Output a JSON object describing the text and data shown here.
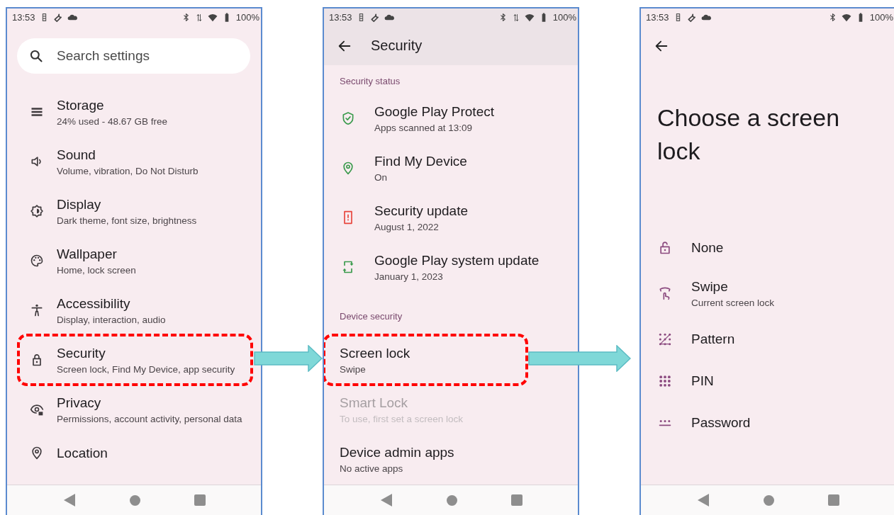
{
  "settings_screen": {
    "status_bar": {
      "time": "13:53",
      "battery": "100%"
    },
    "search": {
      "placeholder": "Search settings"
    },
    "items": [
      {
        "title": "Storage",
        "subtitle": "24% used - 48.67 GB free",
        "highlighted": false
      },
      {
        "title": "Sound",
        "subtitle": "Volume, vibration, Do Not Disturb",
        "highlighted": false
      },
      {
        "title": "Display",
        "subtitle": "Dark theme, font size, brightness",
        "highlighted": false
      },
      {
        "title": "Wallpaper",
        "subtitle": "Home, lock screen",
        "highlighted": false
      },
      {
        "title": "Accessibility",
        "subtitle": "Display, interaction, audio",
        "highlighted": false
      },
      {
        "title": "Security",
        "subtitle": "Screen lock, Find My Device, app security",
        "highlighted": true
      },
      {
        "title": "Privacy",
        "subtitle": "Permissions, account activity, personal data",
        "highlighted": false
      },
      {
        "title": "Location",
        "highlighted": false
      }
    ]
  },
  "security_screen": {
    "status_bar": {
      "time": "13:53",
      "battery": "100%"
    },
    "title": "Security",
    "sections": [
      {
        "header": "Security status",
        "items": [
          {
            "title": "Google Play Protect",
            "subtitle": "Apps scanned at 13:09",
            "highlighted": false,
            "disabled": false
          },
          {
            "title": "Find My Device",
            "subtitle": "On",
            "highlighted": false,
            "disabled": false
          },
          {
            "title": "Security update",
            "subtitle": "August 1, 2022",
            "highlighted": false,
            "disabled": false
          },
          {
            "title": "Google Play system update",
            "subtitle": "January 1, 2023",
            "highlighted": false,
            "disabled": false
          }
        ]
      },
      {
        "header": "Device security",
        "items": [
          {
            "title": "Screen lock",
            "subtitle": "Swipe",
            "highlighted": true,
            "disabled": false
          },
          {
            "title": "Smart Lock",
            "subtitle": "To use, first set a screen lock",
            "highlighted": false,
            "disabled": true
          },
          {
            "title": "Device admin apps",
            "subtitle": "No active apps",
            "highlighted": false,
            "disabled": false
          }
        ]
      }
    ]
  },
  "lock_screen_picker": {
    "status_bar": {
      "time": "13:53",
      "battery": "100%"
    },
    "title": "Choose a screen lock",
    "options": [
      {
        "title": "None"
      },
      {
        "title": "Swipe",
        "subtitle": "Current screen lock"
      },
      {
        "title": "Pattern"
      },
      {
        "title": "PIN"
      },
      {
        "title": "Password"
      }
    ]
  }
}
